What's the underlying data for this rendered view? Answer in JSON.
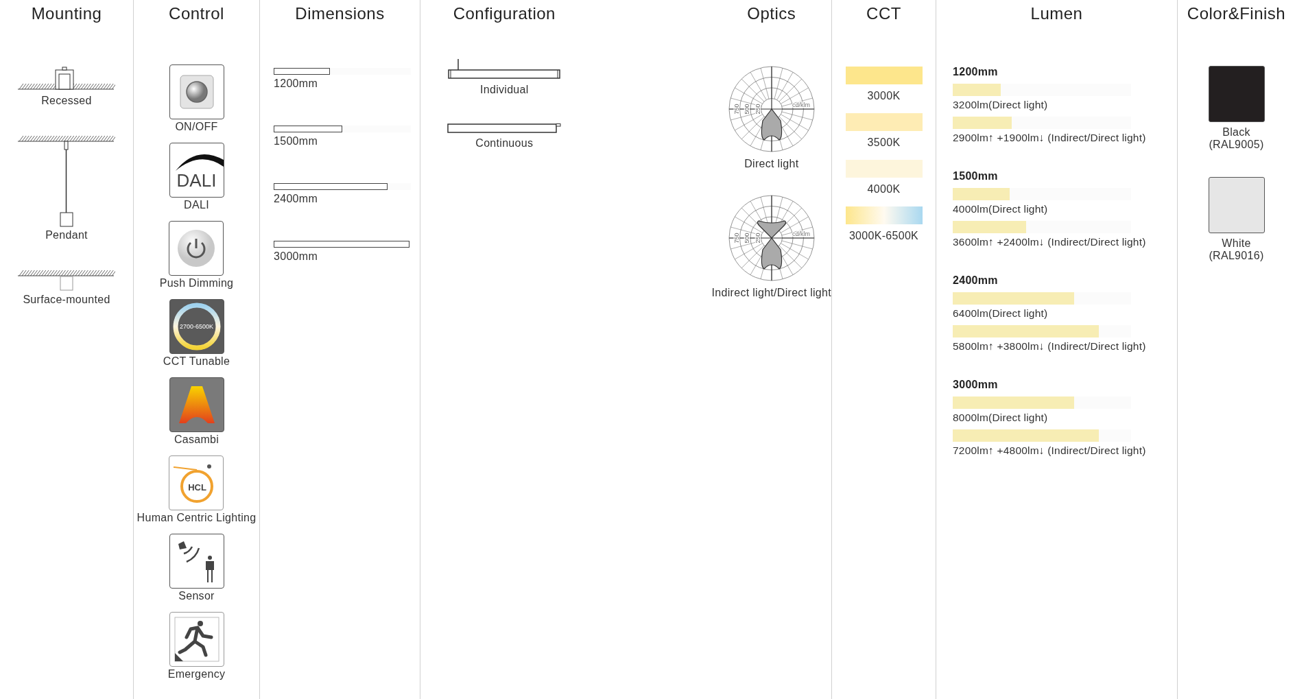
{
  "mounting": {
    "title": "Mounting",
    "items": [
      {
        "kind": "recessed",
        "label": "Recessed"
      },
      {
        "kind": "pendant",
        "label": "Pendant"
      },
      {
        "kind": "surface",
        "label": "Surface-mounted"
      }
    ]
  },
  "control": {
    "title": "Control",
    "items": [
      {
        "kind": "onoff",
        "label": "ON/OFF"
      },
      {
        "kind": "dali",
        "label": "DALI",
        "icon_text": "DALI"
      },
      {
        "kind": "push",
        "label": "Push Dimming"
      },
      {
        "kind": "cct",
        "label": "CCT Tunable",
        "icon_text": "2700-6500K"
      },
      {
        "kind": "casambi",
        "label": "Casambi"
      },
      {
        "kind": "hcl",
        "label": "Human Centric Lighting",
        "icon_text": "HCL"
      },
      {
        "kind": "sensor",
        "label": "Sensor"
      },
      {
        "kind": "emergency",
        "label": "Emergency"
      }
    ]
  },
  "dimensions": {
    "title": "Dimensions",
    "items": [
      {
        "label": "1200mm",
        "level": 0.41
      },
      {
        "label": "1500mm",
        "level": 0.5
      },
      {
        "label": "2400mm",
        "level": 0.83
      },
      {
        "label": "3000mm",
        "level": 0.99
      }
    ]
  },
  "configuration": {
    "title": "Configuration",
    "items": [
      {
        "kind": "individual",
        "label": "Individual"
      },
      {
        "kind": "continuous",
        "label": "Continuous"
      }
    ]
  },
  "optics": {
    "title": "Optics",
    "items": [
      {
        "kind": "direct",
        "label": "Direct light",
        "ticks": [
          "750",
          "500",
          "250",
          "cd/klm"
        ]
      },
      {
        "kind": "indirect_direct",
        "label": "Indirect light/Direct light",
        "ticks": [
          "750",
          "500",
          "250",
          "cd/klm"
        ]
      }
    ]
  },
  "cct": {
    "title": "CCT",
    "items": [
      {
        "kind": "solid",
        "color": "#fde68c",
        "label": "3000K"
      },
      {
        "kind": "solid",
        "color": "#feecb4",
        "label": "3500K"
      },
      {
        "kind": "solid",
        "color": "#fdf5dc",
        "label": "4000K"
      },
      {
        "kind": "gradient",
        "label": "3000K-6500K"
      }
    ]
  },
  "lumen": {
    "title": "Lumen",
    "groups": [
      {
        "length": "1200mm",
        "rows": [
          {
            "level": 0.27,
            "text": "3200lm(Direct light)"
          },
          {
            "level": 0.33,
            "text": "2900lm↑ +1900lm↓ (Indirect/Direct light)"
          }
        ]
      },
      {
        "length": "1500mm",
        "rows": [
          {
            "level": 0.32,
            "text": "4000lm(Direct light)"
          },
          {
            "level": 0.41,
            "text": "3600lm↑ +2400lm↓ (Indirect/Direct light)"
          }
        ]
      },
      {
        "length": "2400mm",
        "rows": [
          {
            "level": 0.68,
            "text": "6400lm(Direct light)"
          },
          {
            "level": 0.82,
            "text": "5800lm↑ +3800lm↓ (Indirect/Direct light)"
          }
        ]
      },
      {
        "length": "3000mm",
        "rows": [
          {
            "level": 0.68,
            "text": "8000lm(Direct light)"
          },
          {
            "level": 0.82,
            "text": "7200lm↑ +4800lm↓ (Indirect/Direct light)"
          }
        ]
      }
    ]
  },
  "finish": {
    "title": "Color&Finish",
    "items": [
      {
        "color": "#231f20",
        "name": "Black",
        "code": "(RAL9005)"
      },
      {
        "color": "#e6e6e6",
        "name": "White",
        "code": "(RAL9016)"
      }
    ]
  }
}
